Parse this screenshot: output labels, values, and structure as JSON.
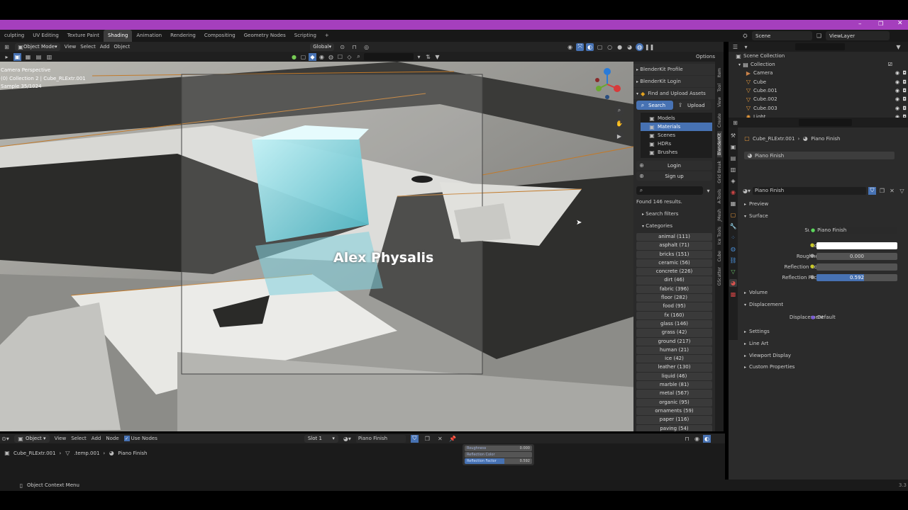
{
  "workspace_tabs": [
    "culpting",
    "UV Editing",
    "Texture Paint",
    "Shading",
    "Animation",
    "Rendering",
    "Compositing",
    "Geometry Nodes",
    "Scripting",
    "+"
  ],
  "active_tab": "Shading",
  "scene": {
    "label": "Scene",
    "view_layer": "ViewLayer"
  },
  "viewport_header": {
    "mode": "Object Mode",
    "menus": [
      "View",
      "Select",
      "Add",
      "Object"
    ],
    "orientation": "Global",
    "options": "Options"
  },
  "viewport_info": {
    "line1": "Camera Perspective",
    "line2": "(0) Collection 2 | Cube_RLExtr.001",
    "line3": "Sample 35/1024"
  },
  "overlay_text": "Alex Physalis",
  "blenderkit": {
    "profile": "BlenderKit Profile",
    "login_title": "BlenderKit Login",
    "upload_assets": "Find and Upload Assets",
    "search": "Search",
    "upload": "Upload",
    "types": [
      "Models",
      "Materials",
      "Scenes",
      "HDRs",
      "Brushes"
    ],
    "active_type": "Materials",
    "login": "Login",
    "signup": "Sign up",
    "found": "Found 146 results.",
    "search_filters": "Search filters",
    "categories_title": "Categories",
    "categories": [
      "animal (111)",
      "asphalt (71)",
      "bricks (151)",
      "ceramic (56)",
      "concrete (226)",
      "dirt (46)",
      "fabric (396)",
      "floor (282)",
      "food (95)",
      "fx (160)",
      "glass (146)",
      "grass (42)",
      "ground (217)",
      "human (21)",
      "ice (42)",
      "leather (130)",
      "liquid (46)",
      "marble (81)",
      "metal (567)",
      "organic (95)",
      "ornaments (59)",
      "paper (116)",
      "paving (54)"
    ]
  },
  "sidebar_tabs": [
    "Item",
    "Tool",
    "View",
    "Create",
    "BlenderKit",
    "Grid Break",
    "A-Tools",
    "JMesh",
    "Ice Tools",
    "Cube",
    "GScatter"
  ],
  "outliner": {
    "root": "Scene Collection",
    "collection": "Collection",
    "items": [
      "Camera",
      "Cube",
      "Cube.001",
      "Cube.002",
      "Cube.003",
      "Light"
    ]
  },
  "properties": {
    "breadcrumb_obj": "Cube_RLExtr.001",
    "breadcrumb_mat": "Piano Finish",
    "slot": "Piano Finish",
    "material": "Piano Finish",
    "preview": "Preview",
    "surface_section": "Surface",
    "surface_label": "Surface",
    "surface_value": "Piano Finish",
    "color_label": "Color",
    "roughness_label": "Roughness",
    "roughness_value": "0.000",
    "reflection_color_label": "Reflection Color",
    "reflection_factor_label": "Reflection Factor",
    "reflection_factor_value": "0.592",
    "reflection_factor": 0.592,
    "volume": "Volume",
    "displacement": "Displacement",
    "displacement_label": "Displacement",
    "displacement_value": "Default",
    "settings": "Settings",
    "line_art": "Line Art",
    "viewport_display": "Viewport Display",
    "custom_properties": "Custom Properties",
    "color_hex": "#ffffff"
  },
  "node_editor": {
    "type": "Object",
    "menus": [
      "View",
      "Select",
      "Add",
      "Node"
    ],
    "use_nodes": "Use Nodes",
    "slot": "Slot 1",
    "material": "Piano Finish",
    "breadcrumb": [
      "Cube_RLExtr.001",
      ".temp.001",
      "Piano Finish"
    ],
    "node_rows": [
      {
        "label": "Roughness",
        "value": "0.000"
      },
      {
        "label": "Reflection Color",
        "value": ""
      },
      {
        "label": "Reflection Factor",
        "value": "0.592"
      }
    ]
  },
  "status": {
    "context_menu": "Object Context Menu",
    "version": "3.3"
  },
  "colors": {
    "title_bar": "#a53fbd",
    "accent": "#4772b3",
    "panel": "#303030",
    "header": "#1d1d1d"
  }
}
